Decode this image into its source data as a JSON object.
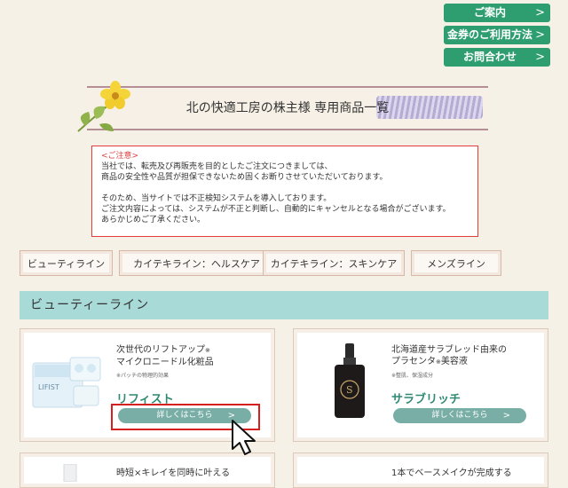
{
  "topnav": [
    {
      "label": "ご案内"
    },
    {
      "label": "金券のご利用方法"
    },
    {
      "label": "お問合わせ"
    }
  ],
  "banner": {
    "title": "北の快適工房の株主様 専用商品一覧"
  },
  "notice": {
    "heading": "<ご注意>",
    "line1": "当社では、転売及び再販売を目的としたご注文につきましては、",
    "line2": "商品の安全性や品質が担保できないため固くお断りさせていただいております。",
    "line3": "そのため、当サイトでは不正検知システムを導入しております。",
    "line4": "ご注文内容によっては、システムが不正と判断し、自動的にキャンセルとなる場合がございます。",
    "line5": "あらかじめご了承ください。"
  },
  "categories": [
    {
      "label": "ビューティライン"
    },
    {
      "label": "カイテキライン：ヘルスケア"
    },
    {
      "label": "カイテキライン：スキンケア"
    },
    {
      "label": "メンズライン"
    }
  ],
  "section": {
    "title": "ビューティーライン"
  },
  "products": [
    {
      "name1": "次世代のリフトアップ",
      "name1_mark": "※",
      "name2": "マイクロニードル化粧品",
      "note": "※パッチの物理的効果",
      "brand": "リフィスト",
      "button": "詳しくはこちら",
      "package_text": "LIFIST"
    },
    {
      "name1": "北海道産サラブレッド由来の",
      "name2": "プラセンタ",
      "name2_mark": "※",
      "name2_tail": "美容液",
      "note": "※整肌、保湿成分",
      "brand": "サラブリッチ",
      "button": "詳しくはこちら",
      "package_text": "S"
    },
    {
      "name1": "時短×キレイを同時に叶える"
    },
    {
      "name1": "1本でベースメイクが完成する"
    }
  ],
  "colors": {
    "green": "#2e9e70",
    "teal": "#a8dad8",
    "alert": "#e23c3c"
  },
  "icons": {
    "chevron": "chevron-right-icon",
    "cursor": "mouse-pointer-icon"
  }
}
